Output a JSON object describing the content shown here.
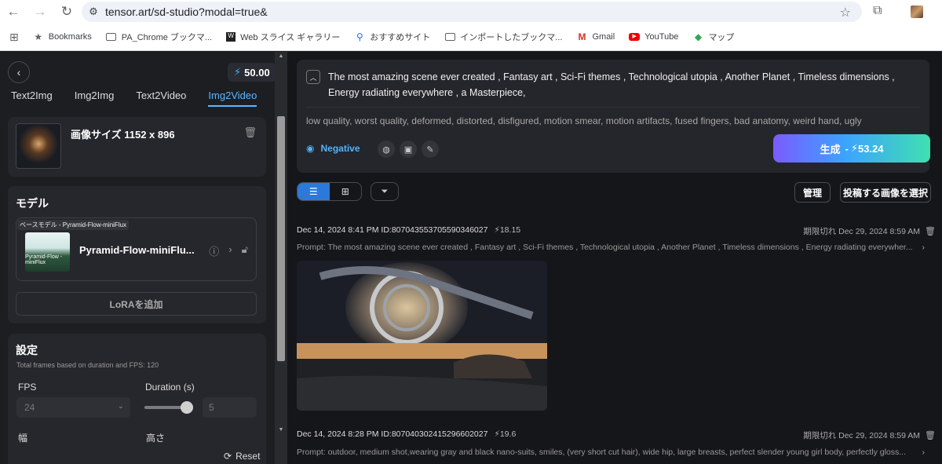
{
  "browser": {
    "url": "tensor.art/sd-studio?modal=true&",
    "bookmarks": [
      {
        "label": "Bookmarks",
        "icon": "star-icon"
      },
      {
        "label": "PA_Chrome ブックマ...",
        "icon": "folder-icon"
      },
      {
        "label": "Web スライス ギャラリー",
        "icon": "web-slice-icon"
      },
      {
        "label": "おすすめサイト",
        "icon": "search-icon"
      },
      {
        "label": "インポートしたブックマ...",
        "icon": "folder-icon"
      },
      {
        "label": "Gmail",
        "icon": "gmail-icon"
      },
      {
        "label": "YouTube",
        "icon": "youtube-icon"
      },
      {
        "label": "マップ",
        "icon": "maps-icon"
      }
    ]
  },
  "sidebar": {
    "credits": "50.00",
    "tabs": [
      "Text2Img",
      "Img2Img",
      "Text2Video",
      "Img2Video"
    ],
    "active_tab": "Img2Video",
    "image_size": "画像サイズ 1152 x 896",
    "model_section": {
      "title": "モデル",
      "tag": "ベースモデル - Pyramid-Flow-miniFlux",
      "thumb_text": "Pyramid-Flow - miniFlux",
      "name": "Pyramid-Flow-miniFlu...",
      "lora_button": "LoRAを追加"
    },
    "settings": {
      "title": "設定",
      "hint": "Total frames based on duration and FPS: 120",
      "fps_label": "FPS",
      "fps_value": "24",
      "duration_label": "Duration (s)",
      "duration_value": "5",
      "duration_level": 0.9,
      "width_label": "幅",
      "height_label": "高さ"
    },
    "reset_label": "Reset"
  },
  "main": {
    "prompt": "The most amazing scene ever created , Fantasy art , Sci-Fi themes , Technological utopia , Another Planet , Timeless dimensions , Energy radiating everywhere , a Masterpiece,",
    "negative_prompt": "low quality, worst quality, deformed, distorted, disfigured, motion smear, motion artifacts, fused fingers, bad anatomy, weird hand, ugly",
    "negative_label": "Negative",
    "generate_label": "生成",
    "generate_cost": "53.24",
    "manage_label": "管理",
    "select_images_label": "投稿する画像を選択",
    "entries": [
      {
        "date": "Dec 14, 2024 8:41 PM",
        "id": "ID:807043553705590346027",
        "cost": "18.15",
        "expires_label": "期限切れ",
        "expires_date": "Dec 29, 2024 8:59 AM",
        "prompt": "Prompt: The most amazing scene ever created , Fantasy art , Sci-Fi themes , Technological utopia , Another Planet , Timeless dimensions , Energy radiating everywher..."
      },
      {
        "date": "Dec 14, 2024 8:28 PM",
        "id": "ID:807040302415296602027",
        "cost": "19.6",
        "expires_label": "期限切れ",
        "expires_date": "Dec 29, 2024 8:59 AM",
        "prompt": "Prompt: outdoor, medium shot,wearing gray and black nano-suits, smiles, (very short cut hair), wide hip, large breasts, perfect slender young girl body, perfectly gloss..."
      }
    ]
  }
}
